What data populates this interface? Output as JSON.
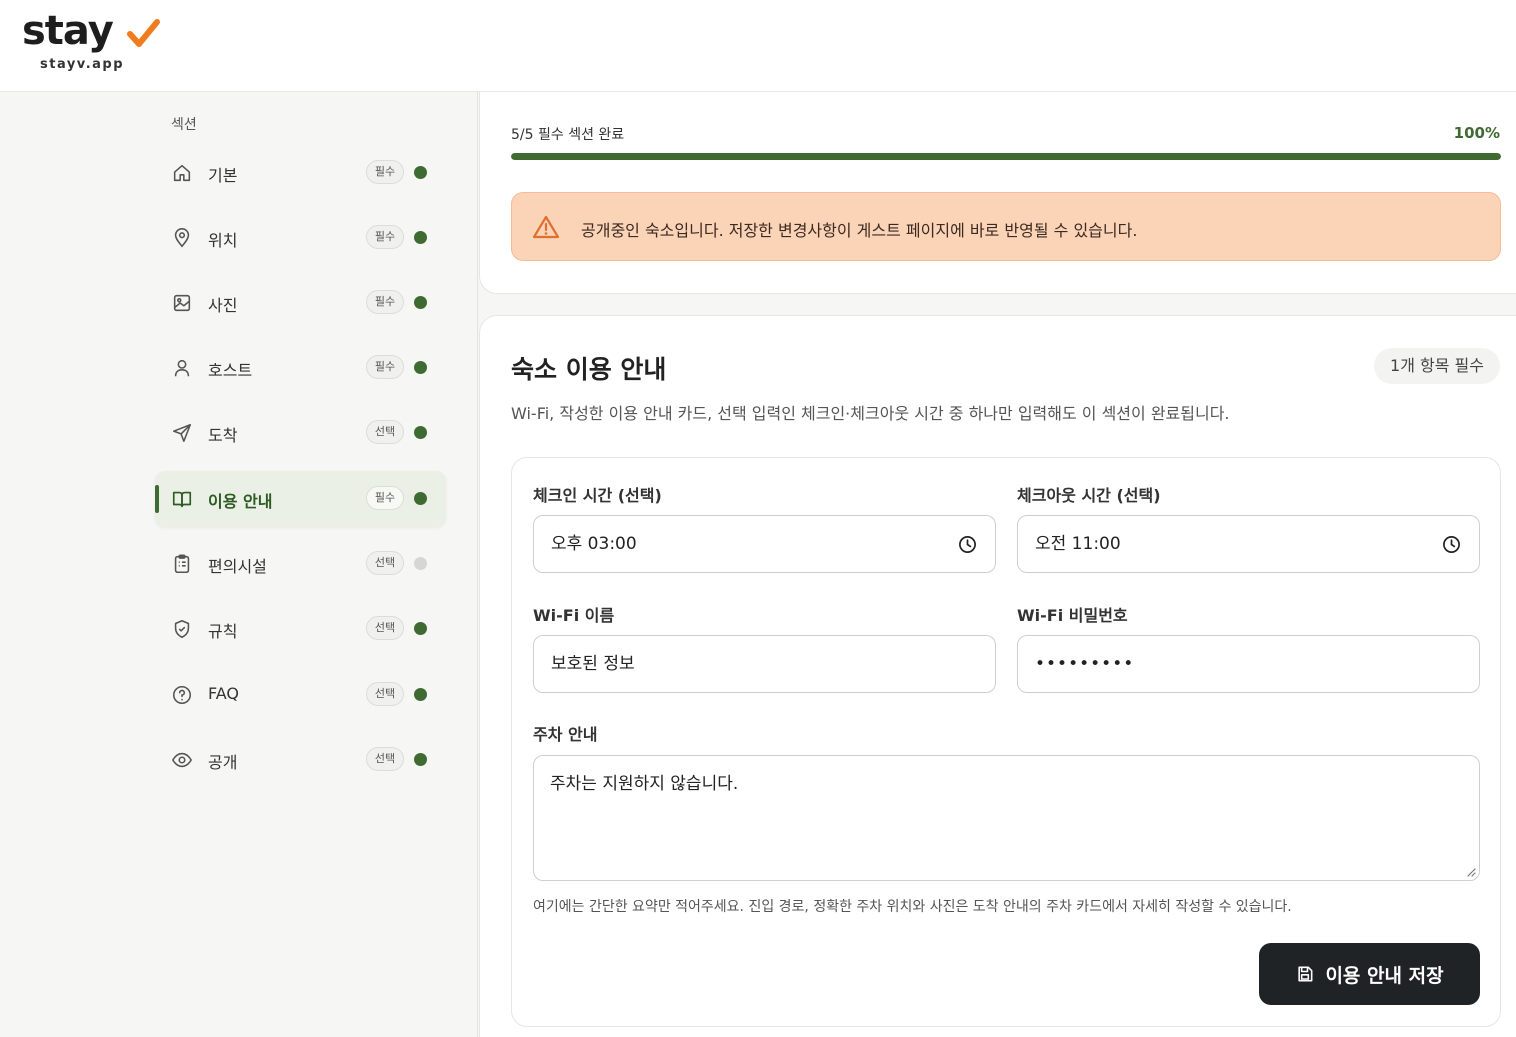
{
  "brand": {
    "wordmark": "stay",
    "domain": "stayv.app",
    "accent_color": "#f07c1e"
  },
  "sidebar": {
    "title": "섹션",
    "items": [
      {
        "icon": "home-icon",
        "label": "기본",
        "badge": "필수",
        "status": "complete"
      },
      {
        "icon": "location-pin-icon",
        "label": "위치",
        "badge": "필수",
        "status": "complete"
      },
      {
        "icon": "image-icon",
        "label": "사진",
        "badge": "필수",
        "status": "complete"
      },
      {
        "icon": "user-icon",
        "label": "호스트",
        "badge": "필수",
        "status": "complete"
      },
      {
        "icon": "send-icon",
        "label": "도착",
        "badge": "선택",
        "status": "complete"
      },
      {
        "icon": "book-icon",
        "label": "이용 안내",
        "badge": "필수",
        "status": "complete",
        "active": true
      },
      {
        "icon": "clipboard-icon",
        "label": "편의시설",
        "badge": "선택",
        "status": "incomplete"
      },
      {
        "icon": "shield-icon",
        "label": "규칙",
        "badge": "선택",
        "status": "complete"
      },
      {
        "icon": "help-circle-icon",
        "label": "FAQ",
        "badge": "선택",
        "status": "complete"
      },
      {
        "icon": "eye-icon",
        "label": "공개",
        "badge": "선택",
        "status": "complete"
      }
    ]
  },
  "progress": {
    "label": "5/5 필수 섹션 완료",
    "percent_text": "100%",
    "fraction": 1.0
  },
  "alert": {
    "icon": "warning-triangle-icon",
    "text": "공개중인 숙소입니다. 저장한 변경사항이 게스트 페이지에 바로 반영될 수 있습니다."
  },
  "section": {
    "title": "숙소 이용 안내",
    "required_chip": "1개 항목 필수",
    "description": "Wi-Fi, 작성한 이용 안내 카드, 선택 입력인 체크인·체크아웃 시간 중 하나만 입력해도 이 섹션이 완료됩니다."
  },
  "form": {
    "checkin": {
      "label": "체크인 시간 (선택)",
      "value": "오후 03:00"
    },
    "checkout": {
      "label": "체크아웃 시간 (선택)",
      "value": "오전 11:00"
    },
    "wifi_name": {
      "label": "Wi-Fi 이름",
      "value": "보호된 정보"
    },
    "wifi_password": {
      "label": "Wi-Fi 비밀번호",
      "value": "•••••••••"
    },
    "parking": {
      "label": "주차 안내",
      "value": "주차는 지원하지 않습니다.",
      "helper": "여기에는 간단한 요약만 적어주세요. 진입 경로, 정확한 주차 위치와 사진은 도착 안내의 주차 카드에서 자세히 작성할 수 있습니다."
    },
    "save_label": "이용 안내 저장"
  },
  "colors": {
    "primary": "#3f6b32",
    "alert_bg": "#fbd3b7",
    "alert_icon": "#e07030",
    "button": "#1f2326"
  }
}
